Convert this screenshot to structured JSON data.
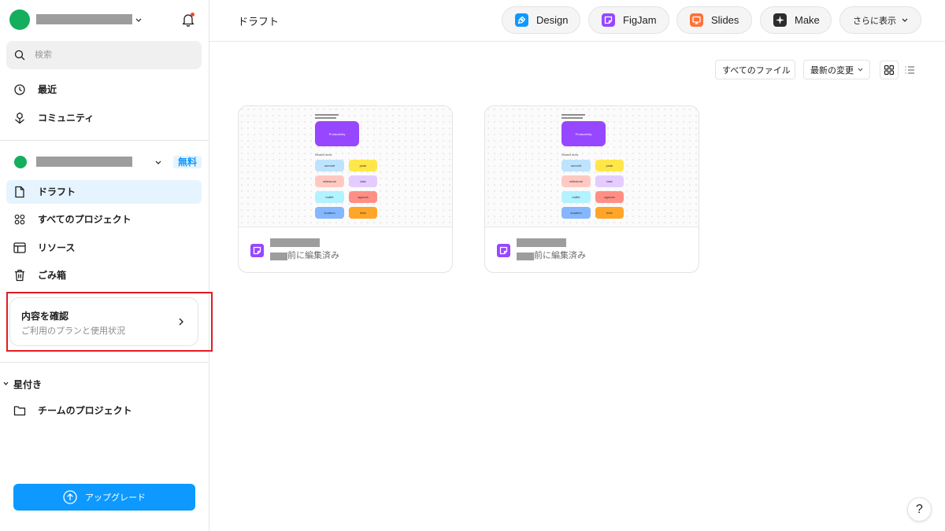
{
  "sidebar": {
    "account": {
      "avatar_color": "#14ae5c"
    },
    "notifications": {
      "has_unread": true
    },
    "search": {
      "placeholder": "検索"
    },
    "nav": [
      {
        "label": "最近",
        "icon": "clock-icon"
      },
      {
        "label": "コミュニティ",
        "icon": "community-icon"
      }
    ],
    "team": {
      "avatar_color": "#14ae5c",
      "plan_badge": "無料",
      "badge_bg": "#e5f4ff"
    },
    "team_nav": [
      {
        "label": "ドラフト",
        "icon": "file-icon",
        "selected": true
      },
      {
        "label": "すべてのプロジェクト",
        "icon": "grid-icon",
        "selected": false
      },
      {
        "label": "リソース",
        "icon": "layout-icon",
        "selected": false
      },
      {
        "label": "ごみ箱",
        "icon": "trash-icon",
        "selected": false
      }
    ],
    "plan_card": {
      "title": "内容を確認",
      "subtitle": "ご利用のプランと使用状況"
    },
    "starred": {
      "label": "星付き",
      "expanded": true,
      "items": [
        {
          "label": "チームのプロジェクト",
          "icon": "folder-icon"
        }
      ]
    },
    "upgrade": {
      "label": "アップグレード",
      "color": "#0d99ff"
    }
  },
  "header": {
    "title": "ドラフト",
    "create_buttons": [
      {
        "label": "Design",
        "icon": "design-icon",
        "color": "#0d99ff"
      },
      {
        "label": "FigJam",
        "icon": "figjam-icon",
        "color": "#9747ff"
      },
      {
        "label": "Slides",
        "icon": "slides-icon",
        "color": "#ff7237"
      },
      {
        "label": "Make",
        "icon": "make-icon",
        "color": "#2c2c2c"
      }
    ],
    "more_label": "さらに表示"
  },
  "toolbar": {
    "filter": "すべてのファイル",
    "sort": "最新の変更",
    "view_mode": "grid"
  },
  "files": [
    {
      "icon": "figjam-icon",
      "icon_color": "#9747ff",
      "edited_suffix": "前に編集済み",
      "thumbnail": {
        "hero_label": "Productivity",
        "hero_color": "#9747ff",
        "section_label": "Related items",
        "stickies": [
          {
            "label": "summit",
            "color": "#bde3ff"
          },
          {
            "label": "peak",
            "color": "#ffe74a"
          },
          {
            "label": "milestone",
            "color": "#ffc9c1"
          },
          {
            "label": "task",
            "color": "#e4ccff"
          },
          {
            "label": "buffet",
            "color": "#b3f2ff"
          },
          {
            "label": "agenda",
            "color": "#ff8f85"
          },
          {
            "label": "duration",
            "color": "#85b7ff"
          },
          {
            "label": "tribe",
            "color": "#ffa629"
          }
        ]
      }
    },
    {
      "icon": "figjam-icon",
      "icon_color": "#9747ff",
      "edited_suffix": "前に編集済み",
      "thumbnail": {
        "hero_label": "Productivity",
        "hero_color": "#9747ff",
        "section_label": "Related items",
        "stickies": [
          {
            "label": "summit",
            "color": "#bde3ff"
          },
          {
            "label": "peak",
            "color": "#ffe74a"
          },
          {
            "label": "milestone",
            "color": "#ffc9c1"
          },
          {
            "label": "task",
            "color": "#e4ccff"
          },
          {
            "label": "buffet",
            "color": "#b3f2ff"
          },
          {
            "label": "agenda",
            "color": "#ff8f85"
          },
          {
            "label": "duration",
            "color": "#85b7ff"
          },
          {
            "label": "tribe",
            "color": "#ffa629"
          }
        ]
      }
    }
  ],
  "help": {
    "label": "?"
  }
}
